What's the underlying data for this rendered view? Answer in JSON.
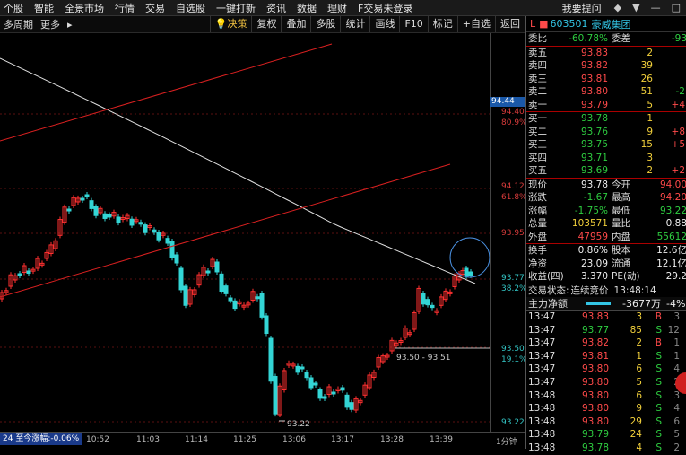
{
  "topmenu": [
    "个股",
    "智能",
    "全景市场",
    "行情",
    "交易",
    "自选股",
    "一键打新",
    "资讯",
    "数据",
    "理财",
    "F交易未登录"
  ],
  "topright": {
    "help": "我要提问"
  },
  "toolbar": {
    "period": "多周期",
    "more": "更多",
    "buttons": [
      "决策",
      "复权",
      "叠加",
      "多股",
      "统计",
      "画线",
      "F10",
      "标记",
      "+自选",
      "返回"
    ]
  },
  "chart_axis": {
    "ticks": [
      "94.44",
      "94.40",
      "80.9%",
      "94.12",
      "61.8%",
      "93.95",
      "93.77",
      "38.2%",
      "93.50",
      "19.1%",
      "93.22"
    ],
    "current_price": "94.44",
    "annotation_range": "93.50 - 93.51",
    "annotation_low": "93.22"
  },
  "timebar": {
    "caption": "24 至今涨幅:-0.06%",
    "times": [
      "10:52",
      "11:03",
      "11:14",
      "11:25",
      "13:06",
      "13:17",
      "13:28",
      "13:39"
    ],
    "period": "1分钟"
  },
  "stock": {
    "code": "603501",
    "name": "豪威集团",
    "flag": "L"
  },
  "weibi": {
    "label1": "委比",
    "value1": "-60.78%",
    "label2": "委差",
    "value2": "-93"
  },
  "asks": [
    {
      "label": "卖五",
      "price": "93.83",
      "vol": "2",
      "chg": ""
    },
    {
      "label": "卖四",
      "price": "93.82",
      "vol": "39",
      "chg": ""
    },
    {
      "label": "卖三",
      "price": "93.81",
      "vol": "26",
      "chg": ""
    },
    {
      "label": "卖二",
      "price": "93.80",
      "vol": "51",
      "chg": "-2"
    },
    {
      "label": "卖一",
      "price": "93.79",
      "vol": "5",
      "chg": "+4"
    }
  ],
  "bids": [
    {
      "label": "买一",
      "price": "93.78",
      "vol": "1",
      "chg": ""
    },
    {
      "label": "买二",
      "price": "93.76",
      "vol": "9",
      "chg": "+8"
    },
    {
      "label": "买三",
      "price": "93.75",
      "vol": "15",
      "chg": "+5"
    },
    {
      "label": "买四",
      "price": "93.71",
      "vol": "3",
      "chg": ""
    },
    {
      "label": "买五",
      "price": "93.69",
      "vol": "2",
      "chg": "+2"
    }
  ],
  "quote": [
    {
      "l1": "现价",
      "v1": "93.78",
      "l2": "今开",
      "v2": "94.00"
    },
    {
      "l1": "涨跌",
      "v1": "-1.67",
      "l2": "最高",
      "v2": "94.20"
    },
    {
      "l1": "涨幅",
      "v1": "-1.75%",
      "l2": "最低",
      "v2": "93.22"
    },
    {
      "l1": "总量",
      "v1": "103571",
      "l2": "量比",
      "v2": "0.88"
    },
    {
      "l1": "外盘",
      "v1": "47959",
      "l2": "内盘",
      "v2": "55612"
    }
  ],
  "quote2": [
    {
      "l1": "换手",
      "v1": "0.86%",
      "l2": "股本",
      "v2": "12.6亿"
    },
    {
      "l1": "净资",
      "v1": "23.09",
      "l2": "流通",
      "v2": "12.1亿"
    },
    {
      "l1": "收益(四)",
      "v1": "3.370",
      "l2": "PE(动)",
      "v2": "29.2"
    }
  ],
  "status": {
    "label": "交易状态:",
    "value": "连续竞价",
    "time": "13:48:14"
  },
  "mainflow": {
    "label": "主力净额",
    "value": "-3677万",
    "pct": "-4%"
  },
  "trades": [
    {
      "t": "13:47",
      "p": "93.83",
      "v": "3",
      "s": "B",
      "n": "3"
    },
    {
      "t": "13:47",
      "p": "93.77",
      "v": "85",
      "s": "S",
      "n": "12"
    },
    {
      "t": "13:47",
      "p": "93.82",
      "v": "2",
      "s": "B",
      "n": "1"
    },
    {
      "t": "13:47",
      "p": "93.81",
      "v": "1",
      "s": "S",
      "n": "1"
    },
    {
      "t": "13:47",
      "p": "93.80",
      "v": "6",
      "s": "S",
      "n": "4"
    },
    {
      "t": "13:47",
      "p": "93.80",
      "v": "5",
      "s": "S",
      "n": "2"
    },
    {
      "t": "13:48",
      "p": "93.80",
      "v": "6",
      "s": "S",
      "n": "3"
    },
    {
      "t": "13:48",
      "p": "93.80",
      "v": "9",
      "s": "S",
      "n": "4"
    },
    {
      "t": "13:48",
      "p": "93.80",
      "v": "29",
      "s": "S",
      "n": "6"
    },
    {
      "t": "13:48",
      "p": "93.79",
      "v": "24",
      "s": "S",
      "n": "5"
    },
    {
      "t": "13:48",
      "p": "93.78",
      "v": "4",
      "s": "S",
      "n": "2"
    }
  ],
  "colors": {
    "up": "#ff3030",
    "down": "#33d5d5",
    "ma": "#e0e0e0",
    "trend": "#d82020",
    "accent": "#1a58a8"
  }
}
